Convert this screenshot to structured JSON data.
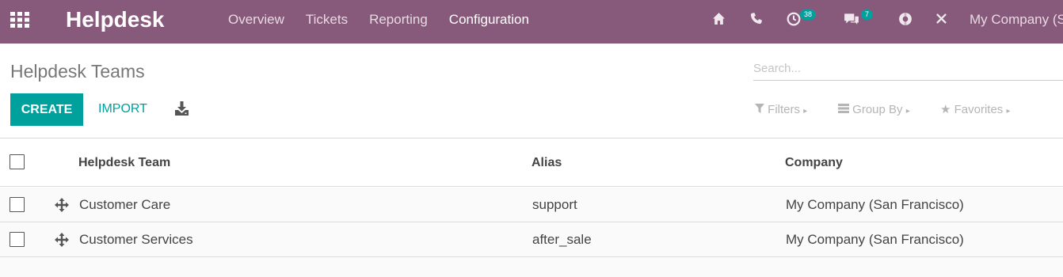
{
  "navbar": {
    "brand": "Helpdesk",
    "menu": [
      {
        "label": "Overview",
        "active": false
      },
      {
        "label": "Tickets",
        "active": false
      },
      {
        "label": "Reporting",
        "active": false
      },
      {
        "label": "Configuration",
        "active": true
      }
    ],
    "icons": [
      "home-icon",
      "phone-icon",
      "activity-icon",
      "chat-icon",
      "support-icon",
      "tools-icon"
    ],
    "activity_badge": "38",
    "messages_badge": "7",
    "company": "My Company (S"
  },
  "control_panel": {
    "breadcrumb": "Helpdesk Teams",
    "search_placeholder": "Search...",
    "create_label": "CREATE",
    "import_label": "IMPORT",
    "filters_label": "Filters",
    "group_by_label": "Group By",
    "favorites_label": "Favorites"
  },
  "table": {
    "headers": [
      "Helpdesk Team",
      "Alias",
      "Company"
    ],
    "rows": [
      {
        "team": "Customer Care",
        "alias": "support",
        "company": "My Company (San Francisco)"
      },
      {
        "team": "Customer Services",
        "alias": "after_sale",
        "company": "My Company (San Francisco)"
      }
    ]
  },
  "colors": {
    "navbar": "#875a7b",
    "primary": "#00a09d"
  }
}
